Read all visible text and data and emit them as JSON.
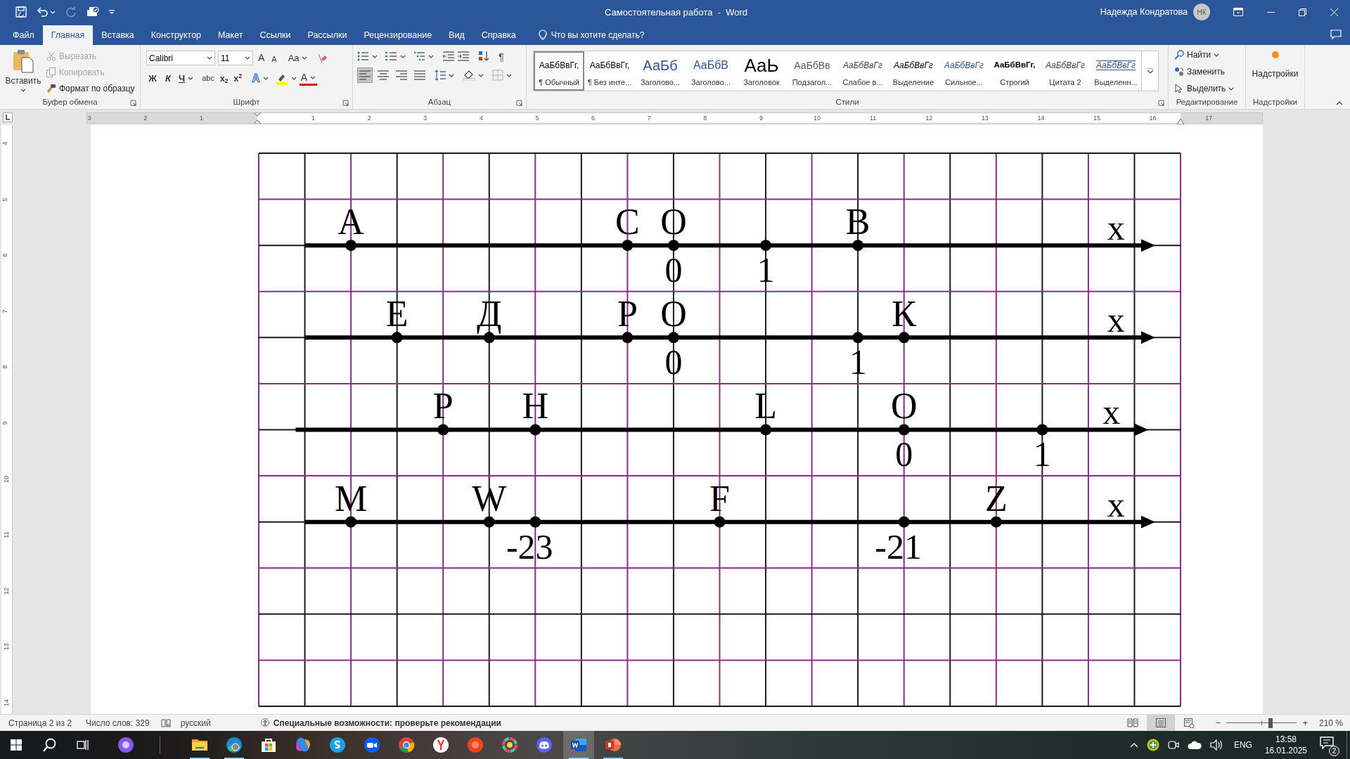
{
  "title_bar": {
    "title": "Самостоятельная работа  -  Word",
    "user": "Надежда Кондратова",
    "avatar": "НК"
  },
  "tabs": [
    {
      "label": "Файл",
      "selected": false
    },
    {
      "label": "Главная",
      "selected": true
    },
    {
      "label": "Вставка",
      "selected": false
    },
    {
      "label": "Конструктор",
      "selected": false
    },
    {
      "label": "Макет",
      "selected": false
    },
    {
      "label": "Ссылки",
      "selected": false
    },
    {
      "label": "Рассылки",
      "selected": false
    },
    {
      "label": "Рецензирование",
      "selected": false
    },
    {
      "label": "Вид",
      "selected": false
    },
    {
      "label": "Справка",
      "selected": false
    }
  ],
  "tell_me": {
    "placeholder": "Что вы хотите сделать?"
  },
  "ribbon": {
    "clipboard": {
      "paste": "Вставить",
      "actions": [
        {
          "label": "Вырезать",
          "disabled": true,
          "kind": "cut"
        },
        {
          "label": "Копировать",
          "disabled": true,
          "kind": "copy"
        },
        {
          "label": "Формат по образцу",
          "disabled": false,
          "kind": "brush"
        }
      ],
      "group": "Буфер обмена"
    },
    "font": {
      "font_name": "Calibri",
      "font_size": "11",
      "row1": [
        {
          "kind": "grow",
          "label": "A"
        },
        {
          "kind": "shrink",
          "label": "A"
        },
        {
          "kind": "case",
          "label": "Aa"
        }
      ],
      "row2": [
        {
          "kind": "bold",
          "label": "Ж"
        },
        {
          "kind": "italic",
          "label": "К"
        },
        {
          "kind": "underline",
          "label": "Ч"
        },
        {
          "kind": "strike",
          "label": "abc"
        },
        {
          "kind": "sub",
          "label": "x$_{2}$"
        },
        {
          "kind": "sup",
          "label": "x$^{2}$"
        },
        {
          "kind": "effects",
          "label": "A"
        },
        {
          "kind": "color",
          "label": "A"
        }
      ],
      "group": "Шрифт"
    },
    "paragraph": {
      "pilcrow": "¶",
      "alignments": [
        {
          "kind": "left",
          "selected": true
        },
        {
          "kind": "center",
          "selected": false
        },
        {
          "kind": "right",
          "selected": false
        },
        {
          "kind": "justify",
          "selected": false
        }
      ],
      "group": "Абзац"
    },
    "styles": {
      "items": [
        {
          "preview": "АаБбВвГг,",
          "name": "¶ Обычный",
          "kind": "normal",
          "selected": true
        },
        {
          "preview": "АаБбВвГг,",
          "name": "¶ Без инте...",
          "kind": "normal",
          "selected": false
        },
        {
          "preview": "АаБб",
          "name": "Заголово...",
          "kind": "heading1",
          "selected": false
        },
        {
          "preview": "АаБбВ",
          "name": "Заголово...",
          "kind": "heading2",
          "selected": false
        },
        {
          "preview": "АаЬ",
          "name": "Заголовок",
          "kind": "title",
          "selected": false
        },
        {
          "preview": "АаБбВв",
          "name": "Подзагол...",
          "kind": "subtitle",
          "selected": false
        },
        {
          "preview": "АаБбВвГг",
          "name": "Слабое в...",
          "kind": "subtle",
          "selected": false
        },
        {
          "preview": "АаБбВвГг",
          "name": "Выделение",
          "kind": "emphasis",
          "selected": false
        },
        {
          "preview": "АаБбВвГг",
          "name": "Сильное...",
          "kind": "intense",
          "selected": false
        },
        {
          "preview": "АаБбВвГг,",
          "name": "Строгий",
          "kind": "strong",
          "selected": false
        },
        {
          "preview": "АаБбВвГг",
          "name": "Цитата 2",
          "kind": "subtle",
          "selected": false
        },
        {
          "preview": "АаБбВвГг",
          "name": "Выделенн...",
          "kind": "intense_quote",
          "selected": false
        }
      ],
      "group": "Стили"
    },
    "editing": {
      "actions": [
        {
          "label": "Найти",
          "kind": "find"
        },
        {
          "label": "Заменить",
          "kind": "replace"
        },
        {
          "label": "Выделить",
          "kind": "select"
        }
      ],
      "group": "Редактирование"
    },
    "addins": {
      "button": "Надстройки",
      "group": "Надстройки"
    }
  },
  "ruler": {
    "horizontal": [
      "3",
      "2",
      "1",
      "1",
      "2",
      "3",
      "4",
      "5",
      "6",
      "7",
      "8",
      "9",
      "10",
      "11",
      "12",
      "13",
      "14",
      "15",
      "16",
      "17"
    ],
    "vertical": [
      "4",
      "5",
      "6",
      "7",
      "8",
      "9",
      "10",
      "11",
      "12",
      "13",
      "14"
    ]
  },
  "document": {
    "number_lines": [
      {
        "axis": "x",
        "points": [
          {
            "name": "А"
          },
          {
            "name": "С"
          },
          {
            "name": "О",
            "value": "0"
          },
          {
            "value": "1"
          },
          {
            "name": "В"
          }
        ]
      },
      {
        "axis": "x",
        "points": [
          {
            "name": "Е"
          },
          {
            "name": "Д"
          },
          {
            "name": "Р"
          },
          {
            "name": "О",
            "value": "0"
          },
          {
            "value": "1"
          },
          {
            "name": "К"
          }
        ]
      },
      {
        "axis": "x",
        "points": [
          {
            "name": "Р"
          },
          {
            "name": "Н"
          },
          {
            "name": "L"
          },
          {
            "name": "О",
            "value": "0"
          },
          {
            "value": "1"
          }
        ]
      },
      {
        "axis": "x",
        "points": [
          {
            "name": "M"
          },
          {
            "name": "W"
          },
          {
            "value": "-23"
          },
          {
            "name": "F"
          },
          {
            "value": "-21"
          },
          {
            "name": "Z"
          }
        ]
      }
    ]
  },
  "status_bar": {
    "page": "Страница 2 из 2",
    "words": "Число слов: 329",
    "language": "русский",
    "accessibility": "Специальные возможности: проверьте рекомендации",
    "views": [
      {
        "kind": "read",
        "selected": false
      },
      {
        "kind": "print",
        "selected": true
      },
      {
        "kind": "web",
        "selected": false
      }
    ],
    "zoom_out": "−",
    "zoom_in": "+",
    "level": 0.63,
    "zoom": "210 %"
  },
  "taskbar": {
    "apps": [
      {
        "kind": "alice",
        "running": false,
        "active": false
      },
      {
        "kind": "folder",
        "running": true,
        "active": false
      },
      {
        "kind": "edge",
        "running": true,
        "active": false
      },
      {
        "kind": "store",
        "running": false,
        "active": false
      },
      {
        "kind": "m365",
        "running": false,
        "active": false
      },
      {
        "kind": "skype",
        "running": false,
        "active": false
      },
      {
        "kind": "zoom",
        "running": false,
        "active": false
      },
      {
        "kind": "chrome",
        "running": false,
        "active": false
      },
      {
        "kind": "ybrowser",
        "running": false,
        "active": false
      },
      {
        "kind": "yandex",
        "running": false,
        "active": false
      },
      {
        "kind": "ring",
        "running": false,
        "active": false
      },
      {
        "kind": "discord",
        "running": false,
        "active": false
      },
      {
        "kind": "word",
        "running": true,
        "active": true
      },
      {
        "kind": "powerpoint",
        "running": true,
        "active": false
      }
    ],
    "language": "ENG",
    "time": "13:58",
    "date": "16.01.2025",
    "notifications": "2"
  }
}
